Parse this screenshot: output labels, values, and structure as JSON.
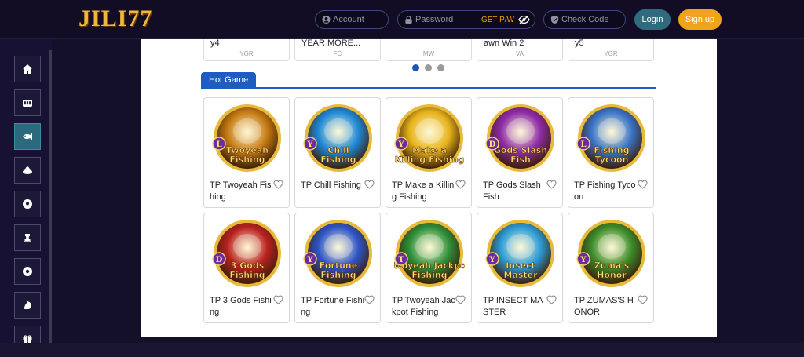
{
  "brand": {
    "logo": "JILI77"
  },
  "header": {
    "account_placeholder": "Account",
    "password_placeholder": "Password",
    "get_pw": "GET P/W",
    "check_code_placeholder": "Check Code",
    "login_label": "Login",
    "signup_label": "Sign up"
  },
  "sidebar": {
    "items": [
      {
        "icon": "home-icon",
        "active": false
      },
      {
        "icon": "slot-machine-icon",
        "active": false
      },
      {
        "icon": "fish-icon",
        "active": true
      },
      {
        "icon": "casino-chip-icon",
        "active": false
      },
      {
        "icon": "soccer-ball-icon",
        "active": false
      },
      {
        "icon": "chess-icon",
        "active": false
      },
      {
        "icon": "lottery-icon",
        "active": false
      },
      {
        "icon": "cockfight-icon",
        "active": false
      },
      {
        "icon": "gift-icon",
        "active": false
      }
    ]
  },
  "previous_row": [
    {
      "title": "y4",
      "provider": "YGR"
    },
    {
      "title": "YEAR MORE...",
      "provider": "FC"
    },
    {
      "title": "",
      "provider": "MW"
    },
    {
      "title": "awn Win 2",
      "provider": "VA"
    },
    {
      "title": "y5",
      "provider": "YGR"
    }
  ],
  "carousel": {
    "pages": 3,
    "active": 1
  },
  "tab": {
    "label": "Hot Game"
  },
  "games": [
    {
      "name": "TP Twoyeah Fishing",
      "badge": "L",
      "art": "Twoyeah Fishing",
      "color": "#c47a12"
    },
    {
      "name": "TP Chill Fishing",
      "badge": "Y",
      "art": "Chill Fishing",
      "color": "#1e88d8"
    },
    {
      "name": "TP Make a Killing Fishing",
      "badge": "Y",
      "art": "Make a Killing Fishing",
      "color": "#e6b21a"
    },
    {
      "name": "TP Gods Slash Fish",
      "badge": "D",
      "art": "Gods Slash Fish",
      "color": "#8d2aa8"
    },
    {
      "name": "TP Fishing Tycoon",
      "badge": "L",
      "art": "Fishing Tycoon",
      "color": "#3a74c9"
    },
    {
      "name": "TP 3 Gods Fishing",
      "badge": "D",
      "art": "3 Gods Fishing",
      "color": "#b82020"
    },
    {
      "name": "TP Fortune Fishing",
      "badge": "Y",
      "art": "Fortune Fishing",
      "color": "#2d55c8"
    },
    {
      "name": "TP Twoyeah Jackpot Fishing",
      "badge": "T",
      "art": "Twoyeah Jackpot Fishing",
      "color": "#2c8f3a"
    },
    {
      "name": "TP INSECT MASTER",
      "badge": "Y",
      "art": "Insect Master",
      "color": "#2a9bd8"
    },
    {
      "name": "TP ZUMAS'S HONOR",
      "badge": "Y",
      "art": "Zuma's Honor",
      "color": "#3c8c2a"
    }
  ]
}
